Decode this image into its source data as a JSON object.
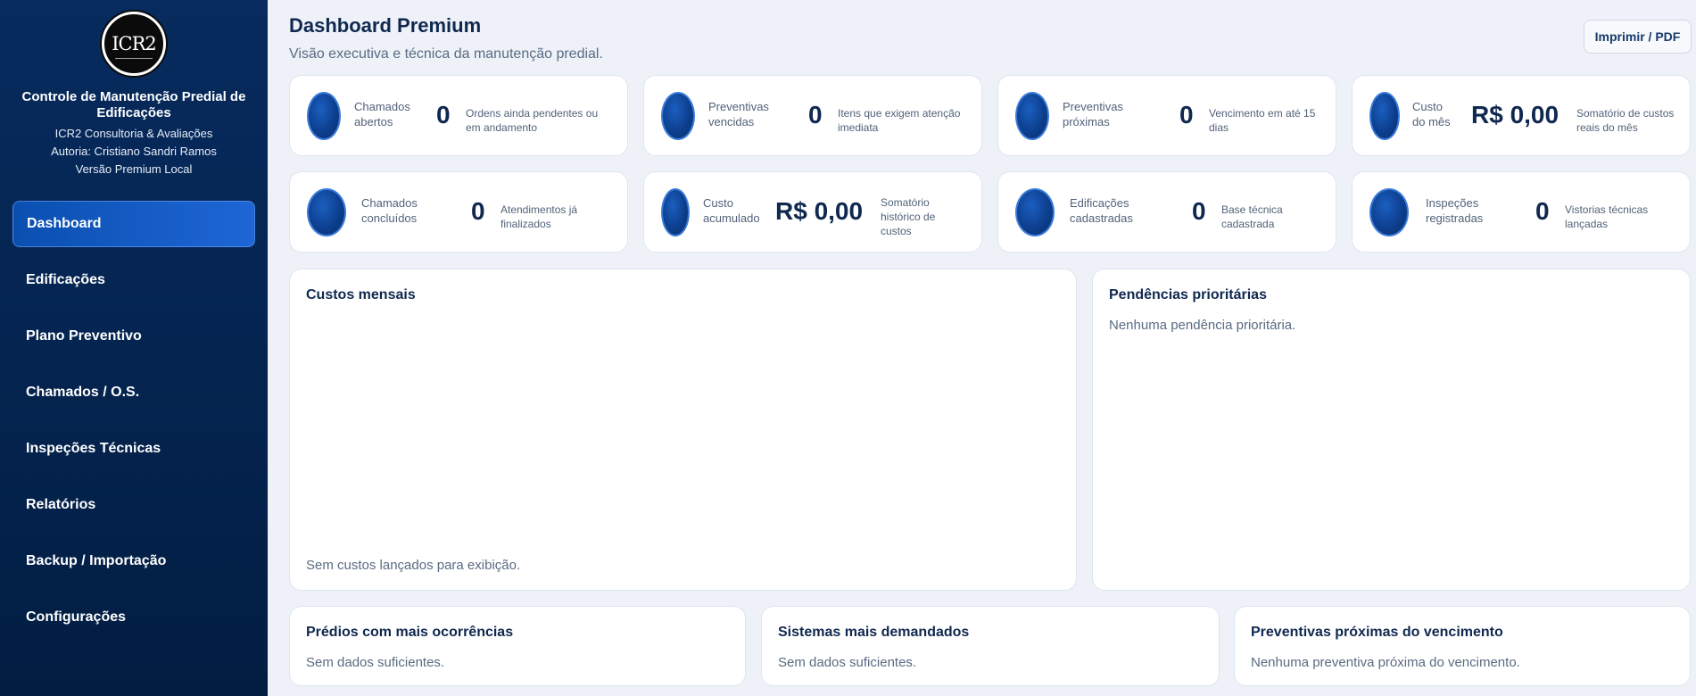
{
  "sidebar": {
    "logo_text": "ICR2",
    "title": "Controle de Manutenção Predial de Edificações",
    "company": "ICR2 Consultoria & Avaliações",
    "author": "Autoria: Cristiano Sandri Ramos",
    "version": "Versão Premium Local",
    "items": [
      {
        "label": "Dashboard",
        "active": true
      },
      {
        "label": "Edificações"
      },
      {
        "label": "Plano Preventivo"
      },
      {
        "label": "Chamados / O.S."
      },
      {
        "label": "Inspeções Técnicas"
      },
      {
        "label": "Relatórios"
      },
      {
        "label": "Backup / Importação"
      },
      {
        "label": "Configurações"
      }
    ]
  },
  "header": {
    "title": "Dashboard Premium",
    "subtitle": "Visão executiva e técnica da manutenção predial.",
    "print_label": "Imprimir / PDF"
  },
  "stats": [
    {
      "label": "Chamados abertos",
      "value": "0",
      "desc": "Ordens ainda pendentes ou em andamento"
    },
    {
      "label": "Preventivas vencidas",
      "value": "0",
      "desc": "Itens que exigem atenção imediata"
    },
    {
      "label": "Preventivas próximas",
      "value": "0",
      "desc": "Vencimento em até 15 dias"
    },
    {
      "label": "Custo do mês",
      "value": "R$ 0,00",
      "desc": "Somatório de custos reais do mês"
    },
    {
      "label": "Chamados concluídos",
      "value": "0",
      "desc": "Atendimentos já finalizados"
    },
    {
      "label": "Custo acumulado",
      "value": "R$ 0,00",
      "desc": "Somatório histórico de custos"
    },
    {
      "label": "Edificações cadastradas",
      "value": "0",
      "desc": "Base técnica cadastrada"
    },
    {
      "label": "Inspeções registradas",
      "value": "0",
      "desc": "Vistorias técnicas lançadas"
    }
  ],
  "panels": {
    "monthly_costs": {
      "title": "Custos mensais",
      "empty": "Sem custos lançados para exibição."
    },
    "priority": {
      "title": "Pendências prioritárias",
      "empty": "Nenhuma pendência prioritária."
    },
    "buildings": {
      "title": "Prédios com mais ocorrências",
      "empty": "Sem dados suficientes."
    },
    "systems": {
      "title": "Sistemas mais demandados",
      "empty": "Sem dados suficientes."
    },
    "upcoming": {
      "title": "Preventivas próximas do vencimento",
      "empty": "Nenhuma preventiva próxima do vencimento."
    }
  },
  "colors": {
    "sidebar_bg": "#04244f",
    "accent": "#1e66d6",
    "page_bg": "#eef2f8",
    "text_dark": "#10284f"
  }
}
